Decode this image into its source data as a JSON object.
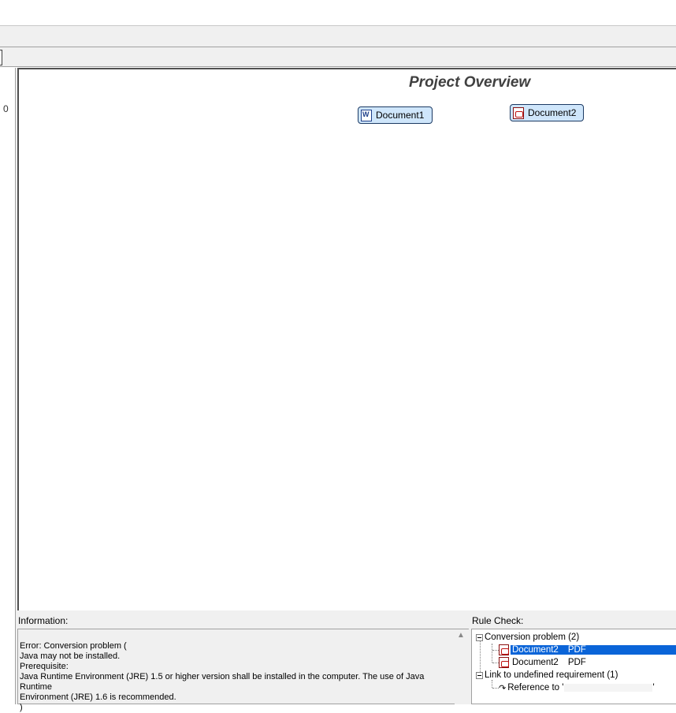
{
  "left_panel": {
    "value": "0"
  },
  "diagram": {
    "title": "Project Overview",
    "nodes": [
      {
        "label": "Document1",
        "icon": "word-doc-icon"
      },
      {
        "label": "Document2",
        "icon": "pdf-doc-icon"
      }
    ]
  },
  "information": {
    "label": "Information:",
    "lines": [
      "Error: Conversion problem  (",
      "Java may not be installed.",
      "Prerequisite:",
      "Java Runtime Environment (JRE) 1.5 or higher version shall be installed in the computer. The use of Java Runtime",
      "Environment (JRE) 1.6 is recommended.",
      ")"
    ]
  },
  "rule_check": {
    "label": "Rule Check:",
    "groups": [
      {
        "label": "Conversion problem  (2)",
        "items": [
          {
            "name": "Document2",
            "type": "PDF",
            "selected": true
          },
          {
            "name": "Document2",
            "type": "PDF",
            "selected": false
          }
        ]
      },
      {
        "label": "Link to undefined requirement (1)",
        "items": [
          {
            "text": "Reference to '",
            "suffix": "'"
          }
        ]
      }
    ]
  },
  "colors": {
    "selection": "#0a64d8",
    "node_fill": "#cfe6fb",
    "title": "#404040"
  }
}
